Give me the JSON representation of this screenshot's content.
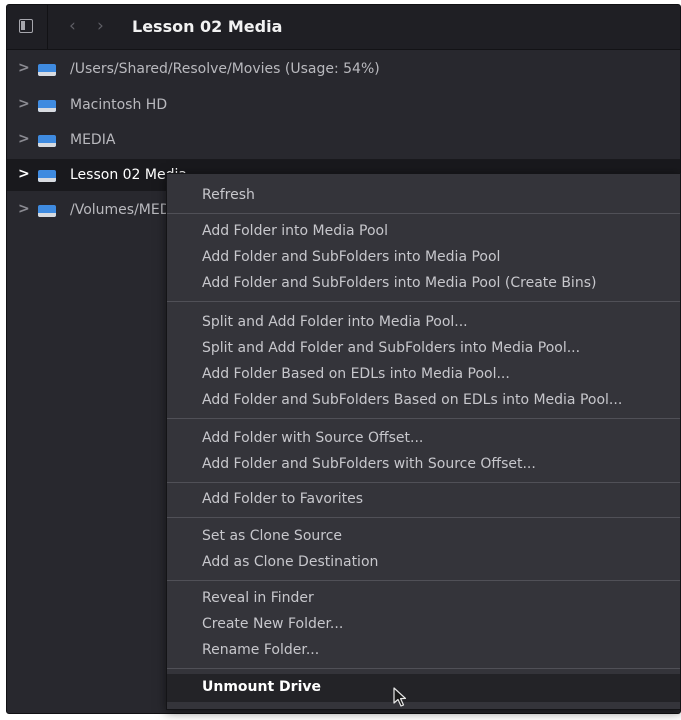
{
  "header": {
    "title": "Lesson 02 Media",
    "back_icon": "chevron-left-icon",
    "forward_icon": "chevron-right-icon",
    "sidebar_icon": "sidebar-toggle-icon"
  },
  "tree": {
    "items": [
      {
        "label": "/Users/Shared/Resolve/Movies (Usage: 54%)",
        "selected": false
      },
      {
        "label": "Macintosh HD",
        "selected": false
      },
      {
        "label": "MEDIA",
        "selected": false
      },
      {
        "label": "Lesson 02 Media",
        "selected": true
      },
      {
        "label": "/Volumes/MEDIA",
        "selected": false
      }
    ],
    "icon": "drive-icon",
    "chevron": ">"
  },
  "context_menu": {
    "items": [
      "Refresh",
      "Add Folder into Media Pool",
      "Add Folder and SubFolders into Media Pool",
      "Add Folder and SubFolders into Media Pool (Create Bins)",
      "Split and Add Folder into Media Pool...",
      "Split and Add Folder and SubFolders into Media Pool...",
      "Add Folder Based on EDLs into Media Pool...",
      "Add Folder and SubFolders Based on EDLs into Media Pool...",
      "Add Folder with Source Offset...",
      "Add Folder and SubFolders with Source Offset...",
      "Add Folder to Favorites",
      "Set as Clone Source",
      "Add as Clone Destination",
      "Reveal in Finder",
      "Create New Folder...",
      "Rename Folder...",
      "Unmount Drive"
    ],
    "hovered": "Unmount Drive"
  },
  "colors": {
    "panel_bg": "#28282e",
    "menu_bg": "#34343a",
    "drive_blue": "#3f8be0",
    "selected_row": "#19191d"
  }
}
